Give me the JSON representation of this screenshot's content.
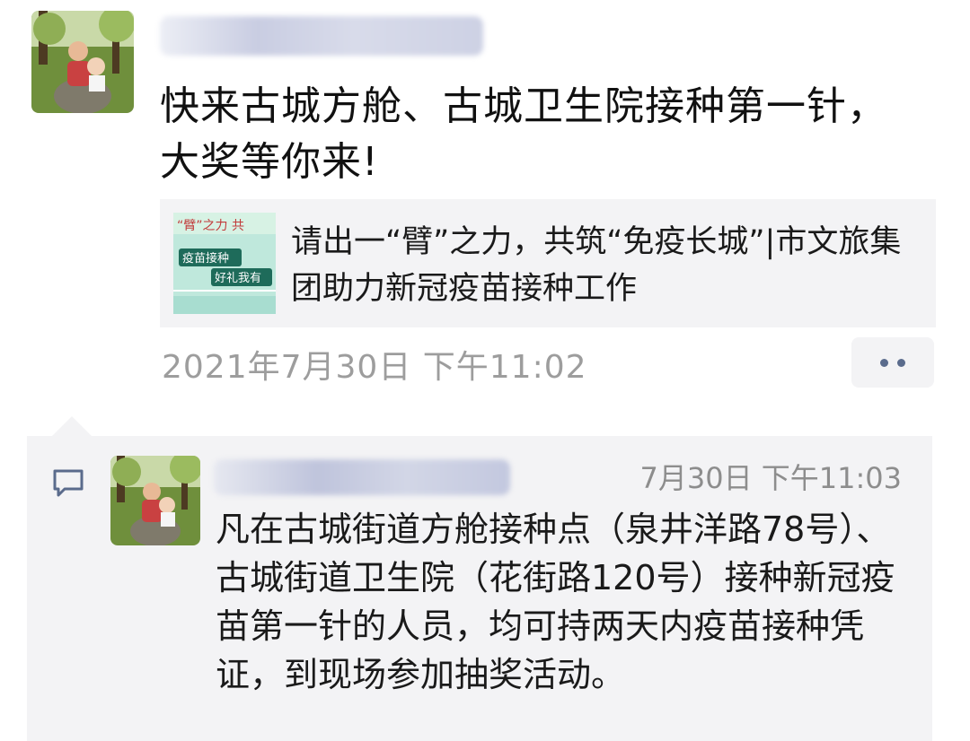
{
  "moment": {
    "text": "快来古城方舱、古城卫生院接种第一针，大奖等你来!",
    "link": {
      "title": "请出一“臂”之力，共筑“免疫长城”|市文旅集团助力新冠疫苗接种工作",
      "thumb_lines": [
        "“臂”之力 共",
        "疫苗接种",
        "好礼我有"
      ]
    },
    "timestamp": "2021年7月30日 下午11:02"
  },
  "comment": {
    "time": "7月30日 下午11:03",
    "text": "凡在古城街道方舱接种点（泉井洋路78号）、古城街道卫生院（花街路120号）接种新冠疫苗第一针的人员，均可持两天内疫苗接种凭证，到现场参加抽奖活动。"
  },
  "colors": {
    "link_bg": "#f3f3f5",
    "timestamp": "#9d9d9d",
    "accent": "#5a6b8c"
  },
  "icons": [
    "more-dots-icon",
    "comment-bubble-icon"
  ]
}
